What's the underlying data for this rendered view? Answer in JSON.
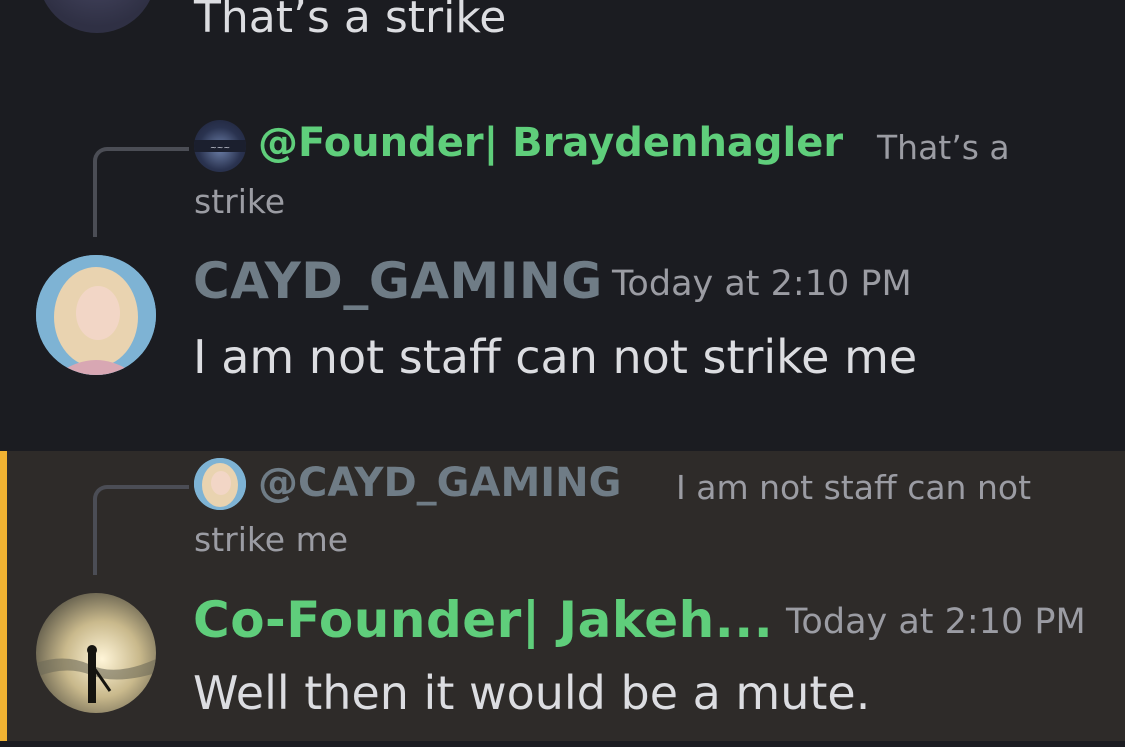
{
  "colors": {
    "background": "#1b1c21",
    "highlight_background": "#2e2b29",
    "highlight_bar": "#f0b232",
    "founder_green": "#5fce7b",
    "cayd_grey": "#6f7c86",
    "text": "#dcdde1",
    "muted": "#9b9ca3"
  },
  "top_message": {
    "text": "That’s a strike"
  },
  "message_1": {
    "reply": {
      "author": "@Founder| Braydenhagler",
      "text_line1": "That’s a",
      "text_line2": "strike"
    },
    "author": "CAYD_GAMING",
    "timestamp": "Today at 2:10 PM",
    "text": "I am not staff can not strike me"
  },
  "message_2": {
    "reply": {
      "author": "@CAYD_GAMING",
      "text_line1": "I am not staff can not",
      "text_line2": "strike me"
    },
    "author": "Co-Founder| Jakeh...",
    "timestamp": "Today at 2:10 PM",
    "text": "Well then it would be a mute."
  }
}
